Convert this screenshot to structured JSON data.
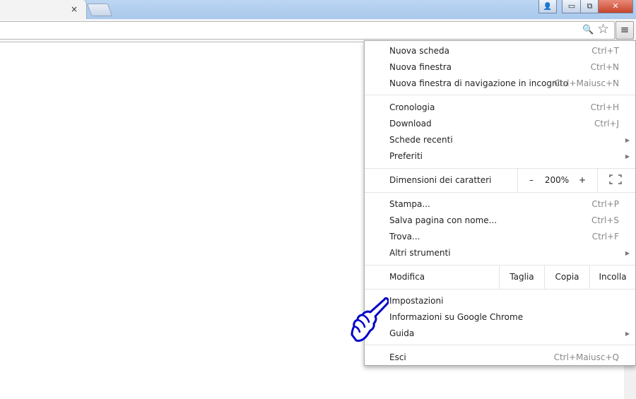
{
  "tab": {
    "close_glyph": "×"
  },
  "window": {
    "minimize": "▭",
    "restore": "⧉",
    "close": "✕",
    "user_icon": "👤"
  },
  "toolbar": {
    "zoom_icon": "🔍",
    "star_icon": "☆",
    "menu_glyph": "≡"
  },
  "menu": {
    "new_tab": {
      "label": "Nuova scheda",
      "shortcut": "Ctrl+T"
    },
    "new_window": {
      "label": "Nuova finestra",
      "shortcut": "Ctrl+N"
    },
    "incognito": {
      "label": "Nuova finestra di navigazione in incognito",
      "shortcut": "Ctrl+Maiusc+N"
    },
    "history": {
      "label": "Cronologia",
      "shortcut": "Ctrl+H"
    },
    "downloads": {
      "label": "Download",
      "shortcut": "Ctrl+J"
    },
    "recent_tabs": {
      "label": "Schede recenti"
    },
    "bookmarks": {
      "label": "Preferiti"
    },
    "zoom": {
      "label": "Dimensioni dei caratteri",
      "minus": "–",
      "value": "200%",
      "plus": "+"
    },
    "print": {
      "label": "Stampa...",
      "shortcut": "Ctrl+P"
    },
    "save_as": {
      "label": "Salva pagina con nome...",
      "shortcut": "Ctrl+S"
    },
    "find": {
      "label": "Trova...",
      "shortcut": "Ctrl+F"
    },
    "more_tools": {
      "label": "Altri strumenti"
    },
    "edit": {
      "label": "Modifica",
      "cut": "Taglia",
      "copy": "Copia",
      "paste": "Incolla"
    },
    "settings": {
      "label": "Impostazioni"
    },
    "about": {
      "label": "Informazioni su Google Chrome"
    },
    "help": {
      "label": "Guida"
    },
    "exit": {
      "label": "Esci",
      "shortcut": "Ctrl+Maiusc+Q"
    }
  },
  "colors": {
    "titlebar": "#a9c8ec",
    "pointer_hand": "#0000c8"
  }
}
